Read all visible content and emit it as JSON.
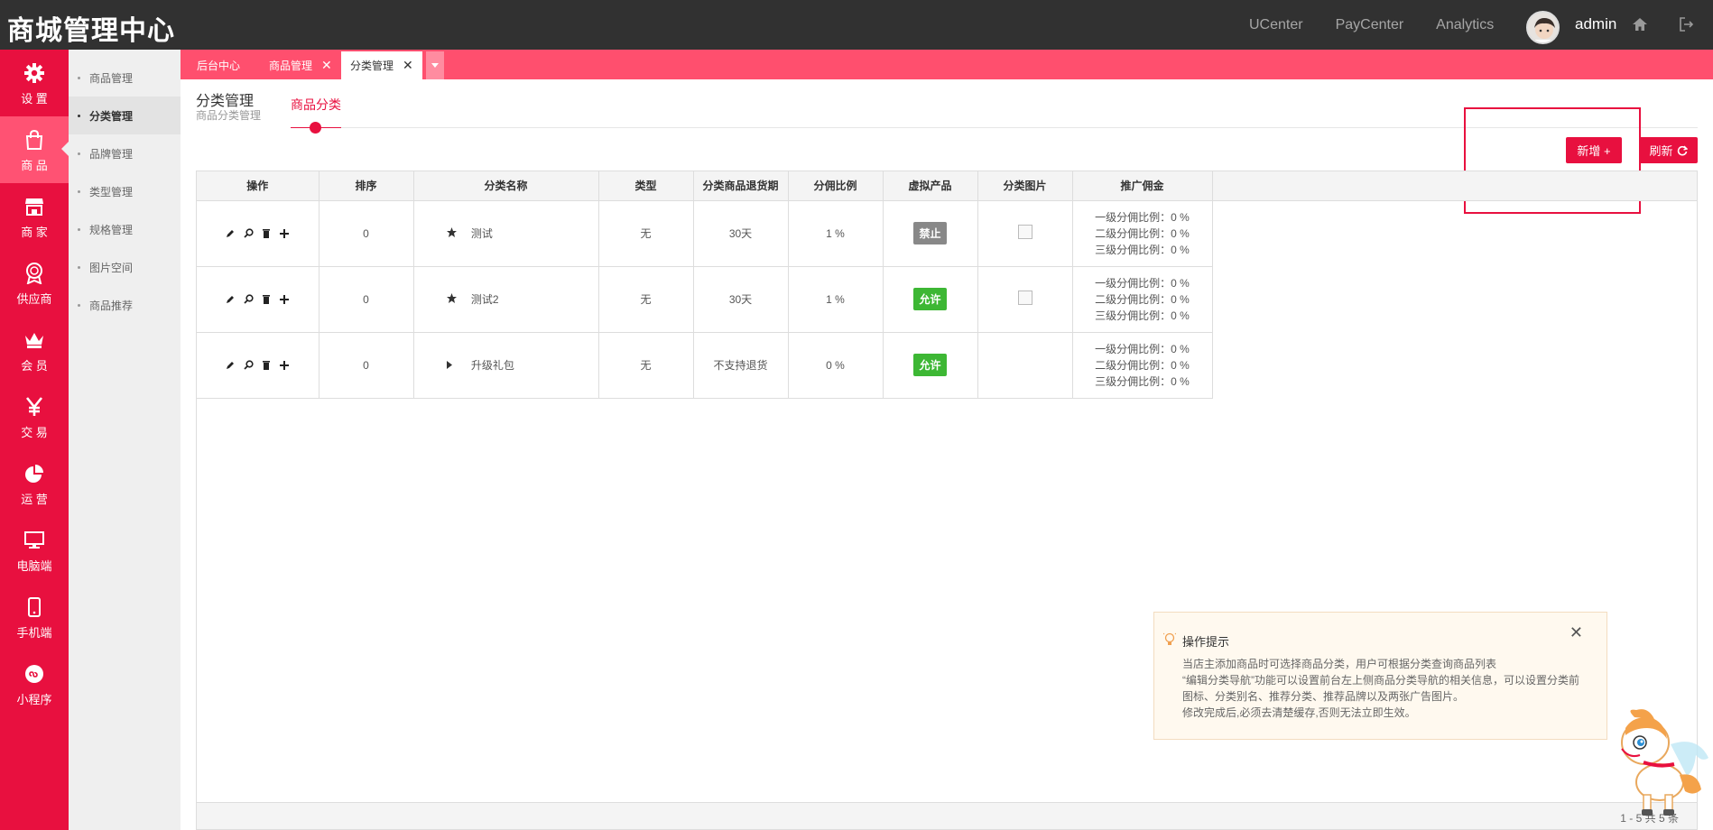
{
  "app": {
    "title": "商城管理中心"
  },
  "topbar": {
    "links": [
      "UCenter",
      "PayCenter",
      "Analytics"
    ],
    "username": "admin",
    "icons": [
      "home-icon",
      "logout-icon"
    ]
  },
  "sidenav": {
    "items": [
      {
        "label": "设 置",
        "icon": "gear-icon"
      },
      {
        "label": "商 品",
        "icon": "shopping-bag-icon"
      },
      {
        "label": "商 家",
        "icon": "store-icon"
      },
      {
        "label": "供应商",
        "icon": "medal-icon"
      },
      {
        "label": "会 员",
        "icon": "crown-icon"
      },
      {
        "label": "交 易",
        "icon": "yen-icon"
      },
      {
        "label": "运 营",
        "icon": "pie-chart-icon"
      },
      {
        "label": "电脑端",
        "icon": "monitor-icon"
      },
      {
        "label": "手机端",
        "icon": "mobile-icon"
      },
      {
        "label": "小程序",
        "icon": "mini-program-icon"
      }
    ],
    "active": "商 品"
  },
  "subnav": {
    "items": [
      "商品管理",
      "分类管理",
      "品牌管理",
      "类型管理",
      "规格管理",
      "图片空间",
      "商品推荐"
    ],
    "active": "分类管理"
  },
  "tabs": [
    {
      "label": "后台中心"
    },
    {
      "label": "商品管理"
    },
    {
      "label": "分类管理"
    }
  ],
  "tab_close": "✕",
  "page": {
    "title": "分类管理",
    "subtitle": "商品分类管理",
    "subtab": "商品分类"
  },
  "toolbar": {
    "add_label": "新增 +",
    "refresh_label": "刷新"
  },
  "table": {
    "columns": [
      "操作",
      "排序",
      "分类名称",
      "类型",
      "分类商品退货期",
      "分佣比例",
      "虚拟产品",
      "分类图片",
      "推广佣金"
    ],
    "rows": [
      {
        "sort": "0",
        "name": "测试",
        "type": "无",
        "return_period": "30天",
        "ratio": "1 %",
        "virtual": "禁止",
        "virtual_state": "off",
        "has_image": true,
        "commission": [
          "一级分佣比例：0 %",
          "二级分佣比例：0 %",
          "三级分佣比例：0 %"
        ]
      },
      {
        "sort": "0",
        "name": "测试2",
        "type": "无",
        "return_period": "30天",
        "ratio": "1 %",
        "virtual": "允许",
        "virtual_state": "on",
        "has_image": true,
        "commission": [
          "一级分佣比例：0 %",
          "二级分佣比例：0 %",
          "三级分佣比例：0 %"
        ]
      },
      {
        "sort": "0",
        "name": "升级礼包",
        "type": "无",
        "return_period": "不支持退货",
        "ratio": "0 %",
        "virtual": "允许",
        "virtual_state": "on",
        "has_image": false,
        "commission": [
          "一级分佣比例：0 %",
          "二级分佣比例：0 %",
          "三级分佣比例：0 %"
        ]
      }
    ],
    "row_markers": [
      "star-icon",
      "star-icon",
      "caret-right-icon"
    ]
  },
  "pager": {
    "text": "1 - 5 共 5 条"
  },
  "tip": {
    "title": "操作提示",
    "lines": [
      "当店主添加商品时可选择商品分类，用户可根据分类查询商品列表",
      "“编辑分类导航”功能可以设置前台左上侧商品分类导航的相关信息，可以设置分类前图标、分类别名、推荐分类、推荐品牌以及两张广告图片。",
      "修改完成后,必须去清楚缓存,否则无法立即生效。"
    ]
  },
  "colors": {
    "brand": "#e8103f",
    "tabbar": "#ff4f6e",
    "topbar": "#313131",
    "allow": "#3db734",
    "deny": "#888888"
  }
}
